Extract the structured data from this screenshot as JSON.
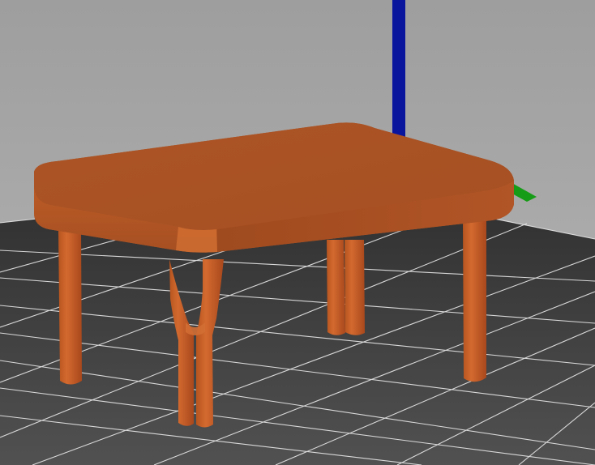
{
  "scene": {
    "background_top": "#a0a0a0",
    "background_bottom": "#b3b3b3",
    "bed_color": "#3a3a3a",
    "grid_color": "#e8e8e8",
    "axis_z_color": "#0b1aa0",
    "axis_y_color": "#1fa21f",
    "model_color": "#c35b24",
    "model_top_color": "#b65726",
    "model_shadow_color": "#8e421b"
  }
}
